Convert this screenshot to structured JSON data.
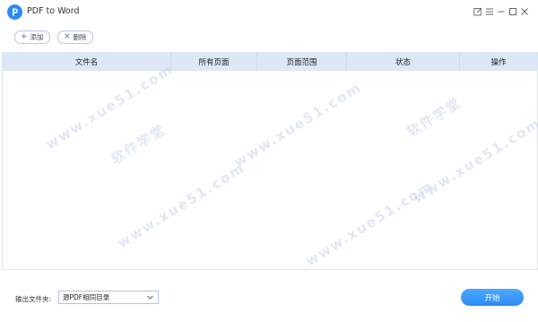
{
  "window": {
    "title": "PDF to Word"
  },
  "toolbar": {
    "add_label": "添加",
    "remove_label": "删除"
  },
  "table": {
    "columns": [
      "文件名",
      "所有页面",
      "页面范围",
      "状态",
      "操作"
    ]
  },
  "footer": {
    "output_label": "输出文件夹:",
    "output_value": "源PDF相同目录",
    "start_label": "开始"
  },
  "watermark": {
    "site": "www.xue51.com",
    "name": "软件学堂"
  },
  "colors": {
    "accent": "#2a8cf5",
    "header_bg": "#dde7f6"
  }
}
